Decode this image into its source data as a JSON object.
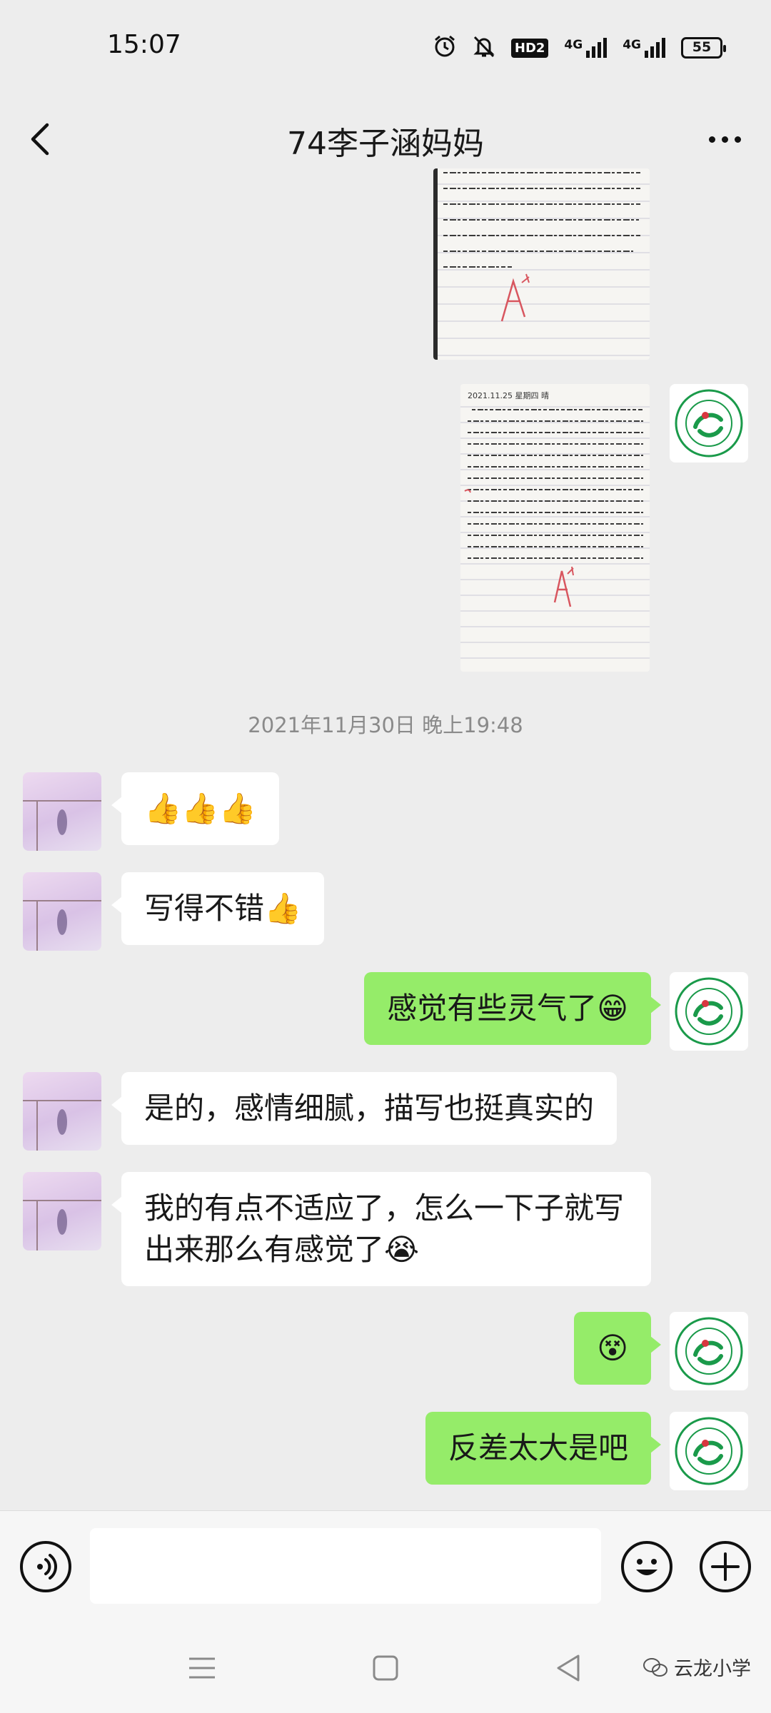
{
  "status_bar": {
    "time": "15:07",
    "hd_label": "HD2",
    "network_1": "4G",
    "network_2": "4G",
    "battery": "55"
  },
  "header": {
    "title": "74李子涵妈妈"
  },
  "chat": {
    "timestamp": "2021年11月30日 晚上19:48",
    "messages": [
      {
        "side": "in",
        "text": "👍👍👍"
      },
      {
        "side": "in",
        "text": "写得不错👍"
      },
      {
        "side": "out",
        "text": "感觉有些灵气了😁"
      },
      {
        "side": "in",
        "text": "是的，感情细腻，描写也挺真实的"
      },
      {
        "side": "in",
        "text": "我的有点不适应了，怎么一下子就写出来那么有感觉了😭"
      },
      {
        "side": "out",
        "text": "😵"
      },
      {
        "side": "out",
        "text": "反差太大是吧"
      }
    ]
  },
  "photo_2": {
    "date_line": "2021.11.25 星期四 晴"
  },
  "watermark": {
    "text": "云龙小学"
  },
  "colors": {
    "background": "#ededed",
    "outgoing_bubble": "#95ec69",
    "incoming_bubble": "#ffffff",
    "school_logo_green": "#1a9a4a"
  }
}
